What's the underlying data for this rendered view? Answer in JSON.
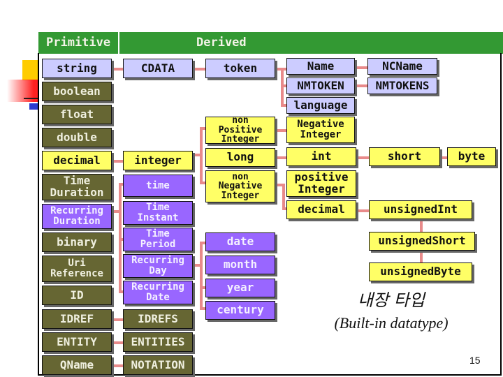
{
  "headers": {
    "primitive": "Primitive",
    "derived": "Derived"
  },
  "colors": {
    "header": "#339933",
    "lavender": "#ccccff",
    "olive": "#666633",
    "yellow": "#ffff66",
    "purple": "#9966ff",
    "connector": "#e88a8a"
  },
  "primitive": {
    "string": "string",
    "boolean": "boolean",
    "float": "float",
    "double": "double",
    "decimal": "decimal",
    "timeDuration": "Time\nDuration",
    "recurringDuration": "Recurring\nDuration",
    "binary": "binary",
    "uriReference": "Uri\nReference",
    "id": "ID",
    "idref": "IDREF",
    "entity": "ENTITY",
    "qname": "QName"
  },
  "derived": {
    "cdata": "CDATA",
    "token": "token",
    "name": "Name",
    "ncname": "NCName",
    "nmtoken": "NMTOKEN",
    "nmtokens": "NMTOKENS",
    "language": "language",
    "integer": "integer",
    "nonPositiveInteger": "non\nPositive\nInteger",
    "negativeInteger": "Negative\nInteger",
    "long": "long",
    "int": "int",
    "short": "short",
    "byte": "byte",
    "nonNegativeInteger": "non\nNegative\nInteger",
    "positiveInteger": "positive\nInteger",
    "decimal2": "decimal",
    "unsignedInt": "unsignedInt",
    "unsignedShort": "unsignedShort",
    "unsignedByte": "unsignedByte",
    "time": "time",
    "timeInstant": "Time\nInstant",
    "timePeriod": "Time\nPeriod",
    "recurringDay": "Recurring\nDay",
    "recurringDate": "Recurring\nDate",
    "date": "date",
    "month": "month",
    "year": "year",
    "century": "century",
    "idrefs": "IDREFS",
    "entities": "ENTITIES",
    "notation": "NOTATION"
  },
  "caption": {
    "korean": "내장 타입",
    "english": "(Built-in datatype)"
  },
  "page_number": "15"
}
